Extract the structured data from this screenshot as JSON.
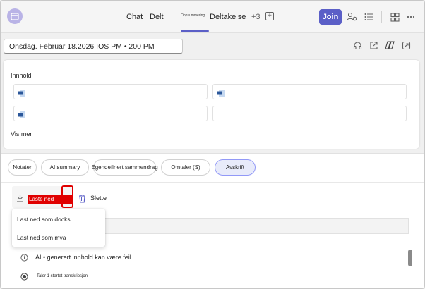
{
  "header": {
    "app_icon": "calendar-icon",
    "tabs": [
      {
        "label": "Chat"
      },
      {
        "label": "Delt"
      },
      {
        "label": "Oppsummering"
      },
      {
        "label": "Deltakelse"
      }
    ],
    "more_tabs_label": "+3",
    "add_tab_icon": "plus-square-icon",
    "join_label": "Join",
    "icons": [
      "people-settings-icon",
      "list-icon",
      "apps-icon",
      "more-icon"
    ],
    "accent_color": "#5b5fc7"
  },
  "meeting": {
    "date_text": "Onsdag. Februar 18.2026 IOS PM • 200 PM",
    "row_icons": [
      "headset-icon",
      "share-icon",
      "copilot-icon",
      "open-external-icon"
    ]
  },
  "content": {
    "title": "Innhold",
    "file_icon": "word-doc-icon",
    "see_more": "Vis mer"
  },
  "recap_tabs": [
    {
      "label": "Notater"
    },
    {
      "label": "AI summary"
    },
    {
      "label": "Egendefinert sammendrag"
    },
    {
      "label": "Omtaler (S)"
    },
    {
      "label": "Avskrift",
      "selected": true
    }
  ],
  "toolbar": {
    "download_label": "Laste ned",
    "delete_label": "Slette",
    "highlight_color": "#e00000"
  },
  "download_menu": {
    "items": [
      {
        "label": "Last ned som docks"
      },
      {
        "label": "Last ned som mva"
      }
    ]
  },
  "transcript": {
    "ai_notice": "AI • generert innhold kan være feil",
    "first_entry": "Taler 1 startet transkripsjon"
  }
}
